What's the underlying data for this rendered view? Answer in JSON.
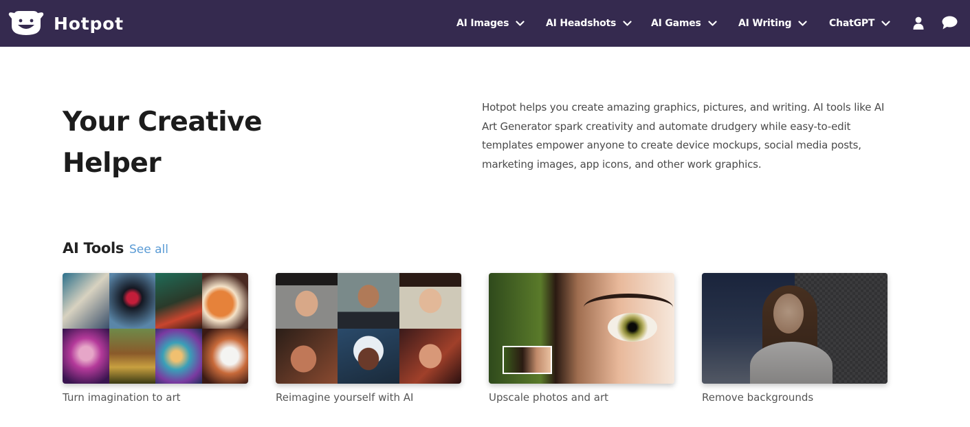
{
  "brand": {
    "name": "Hotpot",
    "logo_icon": "smiling-pot-logo"
  },
  "nav": {
    "items": [
      {
        "label": "AI Images",
        "icon": "chevron-down-icon"
      },
      {
        "label": "AI Headshots",
        "icon": "chevron-down-icon"
      },
      {
        "label": "AI Games",
        "icon": "chevron-down-icon"
      },
      {
        "label": "AI Writing",
        "icon": "chevron-down-icon"
      },
      {
        "label": "ChatGPT",
        "icon": "chevron-down-icon"
      }
    ],
    "account_icon": "user-icon",
    "chat_icon": "chat-bubble-icon"
  },
  "hero": {
    "title": "Your Creative Helper",
    "description": "Hotpot helps you create amazing graphics, pictures, and writing. AI tools like AI Art Generator spark creativity and automate drudgery while easy-to-edit templates empower anyone to create device mockups, social media posts, marketing images, app icons, and other work graphics."
  },
  "ai_tools": {
    "title": "AI Tools",
    "see_all_label": "See all",
    "cards": [
      {
        "caption": "Turn imagination to art"
      },
      {
        "caption": "Reimagine yourself with AI"
      },
      {
        "caption": "Upscale photos and art"
      },
      {
        "caption": "Remove backgrounds"
      }
    ]
  },
  "colors": {
    "navbar_bg": "#352a4f",
    "link": "#5a9bd5",
    "caption": "#555555"
  }
}
